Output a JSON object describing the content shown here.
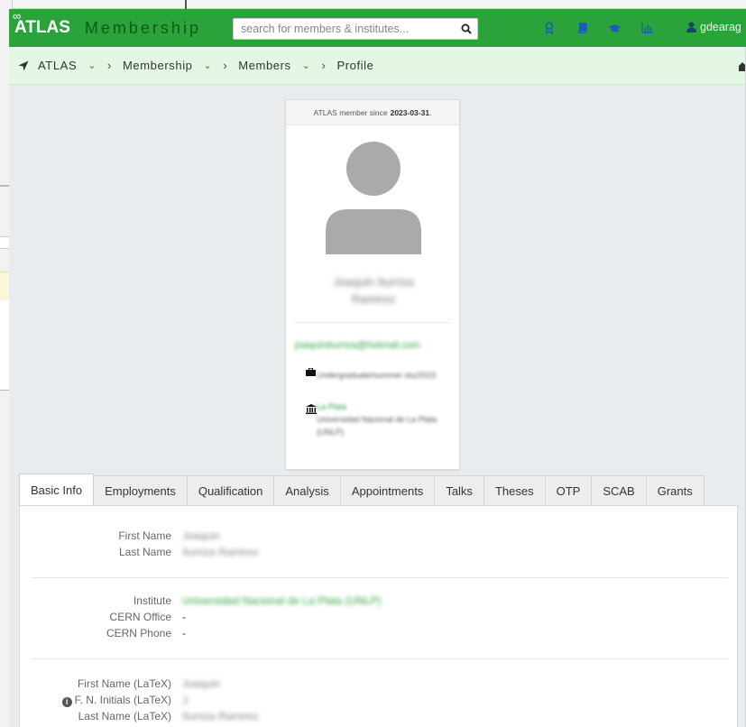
{
  "app": {
    "brand": "ATLAS",
    "app_name": "Membership",
    "search_placeholder": "search for members & institutes...",
    "user": "gdearag"
  },
  "nav_icons": [
    {
      "name": "award-icon",
      "color": "#1e5bb8"
    },
    {
      "name": "book-icon",
      "color": "#1e5bb8"
    },
    {
      "name": "graduation-cap-icon",
      "color": "#1e5bb8"
    },
    {
      "name": "bar-chart-icon",
      "color": "#1e5bb8"
    }
  ],
  "breadcrumb": {
    "items": [
      "ATLAS",
      "Membership",
      "Members",
      "Profile"
    ]
  },
  "profile_card": {
    "member_since_prefix": "ATLAS member since",
    "member_since_date": "2023-03-31",
    "name": "Joaquin Iturriza Ramirez",
    "email": "joaquiniturriza@hotmail.com",
    "employment": "Undergraduate/summer stu/2023",
    "institute_short": "La Plata",
    "institute_full": "Universidad Nacional de La Plata (UNLP)"
  },
  "tabs": [
    "Basic Info",
    "Employments",
    "Qualification",
    "Analysis",
    "Appointments",
    "Talks",
    "Theses",
    "OTP",
    "SCAB",
    "Grants"
  ],
  "basic_info": {
    "first_name_label": "First Name",
    "first_name": "Joaquin",
    "last_name_label": "Last Name",
    "last_name": "Iturriza Ramirez",
    "institute_label": "Institute",
    "institute": "Universidad Nacional de La Plata (UNLP)",
    "cern_office_label": "CERN Office",
    "cern_office": "-",
    "cern_phone_label": "CERN Phone",
    "cern_phone": "-",
    "first_name_latex_label": "First Name (LaTeX)",
    "first_name_latex": "Joaquin",
    "fn_initials_latex_label": "F. N. Initials (LaTeX)",
    "fn_initials_latex": "J.",
    "last_name_latex_label": "Last Name (LaTeX)",
    "last_name_latex": "Iturriza Ramirez"
  },
  "colors": {
    "navbar": "#29a33a",
    "breadcrumb_bg": "#e4f6e4",
    "link": "#29a33a"
  }
}
